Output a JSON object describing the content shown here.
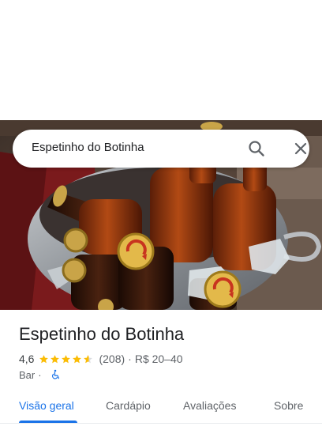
{
  "search": {
    "query": "Espetinho do Botinha",
    "search_icon": "search-icon",
    "close_icon": "close-icon"
  },
  "place": {
    "name": "Espetinho do Botinha",
    "rating": "4,6",
    "stars_value": 4.6,
    "reviews": "(208)",
    "separator": "·",
    "price": "R$ 20–40",
    "category": "Bar",
    "accessibility_icon": "wheelchair-icon"
  },
  "tabs": [
    {
      "label": "Visão geral",
      "active": true
    },
    {
      "label": "Cardápio",
      "active": false
    },
    {
      "label": "Avaliações",
      "active": false
    },
    {
      "label": "Sobre",
      "active": false
    }
  ],
  "colors": {
    "accent": "#1a73e8",
    "star": "#fbbc04",
    "wheelchair": "#1a73e8"
  }
}
